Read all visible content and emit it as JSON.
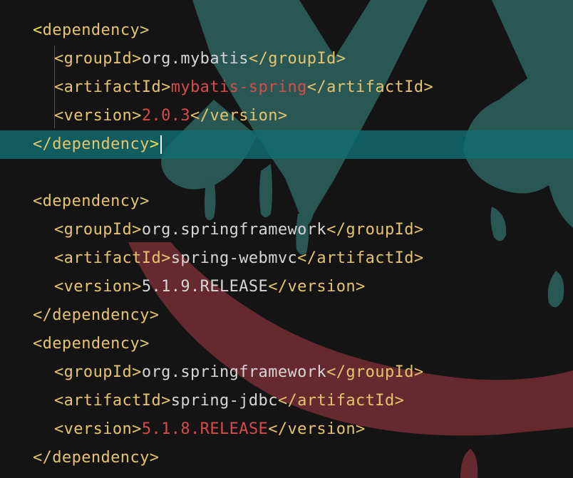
{
  "editor": {
    "colors": {
      "background": "#141414",
      "tag": "#e6c46c",
      "text": "#d6d6d6",
      "highlight_value": "#d94a4a",
      "current_line": "#106e70",
      "bracket_match": "#f1e24a"
    },
    "lines": [
      {
        "indent": 2,
        "current": false,
        "segments": [
          {
            "text": "<",
            "style": "bright"
          },
          {
            "text": "dependency>",
            "style": "tag"
          }
        ]
      },
      {
        "indent": 4,
        "current": false,
        "segments": [
          {
            "text": "<groupId>",
            "style": "tag"
          },
          {
            "text": "org.mybatis",
            "style": "text"
          },
          {
            "text": "</groupId>",
            "style": "tag"
          }
        ]
      },
      {
        "indent": 4,
        "current": false,
        "segments": [
          {
            "text": "<artifactId>",
            "style": "tag"
          },
          {
            "text": "mybatis-spring",
            "style": "red"
          },
          {
            "text": "</artifactId>",
            "style": "tag"
          }
        ]
      },
      {
        "indent": 4,
        "current": false,
        "segments": [
          {
            "text": "<version>",
            "style": "tag"
          },
          {
            "text": "2.0.3",
            "style": "red"
          },
          {
            "text": "</version>",
            "style": "tag"
          }
        ]
      },
      {
        "indent": 2,
        "current": true,
        "caret": true,
        "segments": [
          {
            "text": "</dependency",
            "style": "tag"
          },
          {
            "text": ">",
            "style": "bright"
          }
        ]
      },
      {
        "indent": 0,
        "current": false,
        "segments": []
      },
      {
        "indent": 2,
        "current": false,
        "segments": [
          {
            "text": "<dependency>",
            "style": "tag"
          }
        ]
      },
      {
        "indent": 4,
        "current": false,
        "segments": [
          {
            "text": "<groupId>",
            "style": "tag"
          },
          {
            "text": "org.springframework",
            "style": "text"
          },
          {
            "text": "</groupId>",
            "style": "tag"
          }
        ]
      },
      {
        "indent": 4,
        "current": false,
        "segments": [
          {
            "text": "<artifactId>",
            "style": "tag"
          },
          {
            "text": "spring-webmvc",
            "style": "text"
          },
          {
            "text": "</artifactId>",
            "style": "tag"
          }
        ]
      },
      {
        "indent": 4,
        "current": false,
        "segments": [
          {
            "text": "<version>",
            "style": "tag"
          },
          {
            "text": "5.1.9.RELEASE",
            "style": "text"
          },
          {
            "text": "</version>",
            "style": "tag"
          }
        ]
      },
      {
        "indent": 2,
        "current": false,
        "segments": [
          {
            "text": "</dependency>",
            "style": "tag"
          }
        ]
      },
      {
        "indent": 2,
        "current": false,
        "segments": [
          {
            "text": "<dependency>",
            "style": "tag"
          }
        ]
      },
      {
        "indent": 4,
        "current": false,
        "segments": [
          {
            "text": "<groupId>",
            "style": "tag"
          },
          {
            "text": "org.springframework",
            "style": "text"
          },
          {
            "text": "</groupId>",
            "style": "tag"
          }
        ]
      },
      {
        "indent": 4,
        "current": false,
        "segments": [
          {
            "text": "<artifactId>",
            "style": "tag"
          },
          {
            "text": "spring-jdbc",
            "style": "text"
          },
          {
            "text": "</artifactId>",
            "style": "tag"
          }
        ]
      },
      {
        "indent": 4,
        "current": false,
        "segments": [
          {
            "text": "<version>",
            "style": "tag"
          },
          {
            "text": "5.1.8.RELEASE",
            "style": "red"
          },
          {
            "text": "</version>",
            "style": "tag"
          }
        ]
      },
      {
        "indent": 2,
        "current": false,
        "segments": [
          {
            "text": "</dependency>",
            "style": "tag"
          }
        ]
      }
    ]
  }
}
